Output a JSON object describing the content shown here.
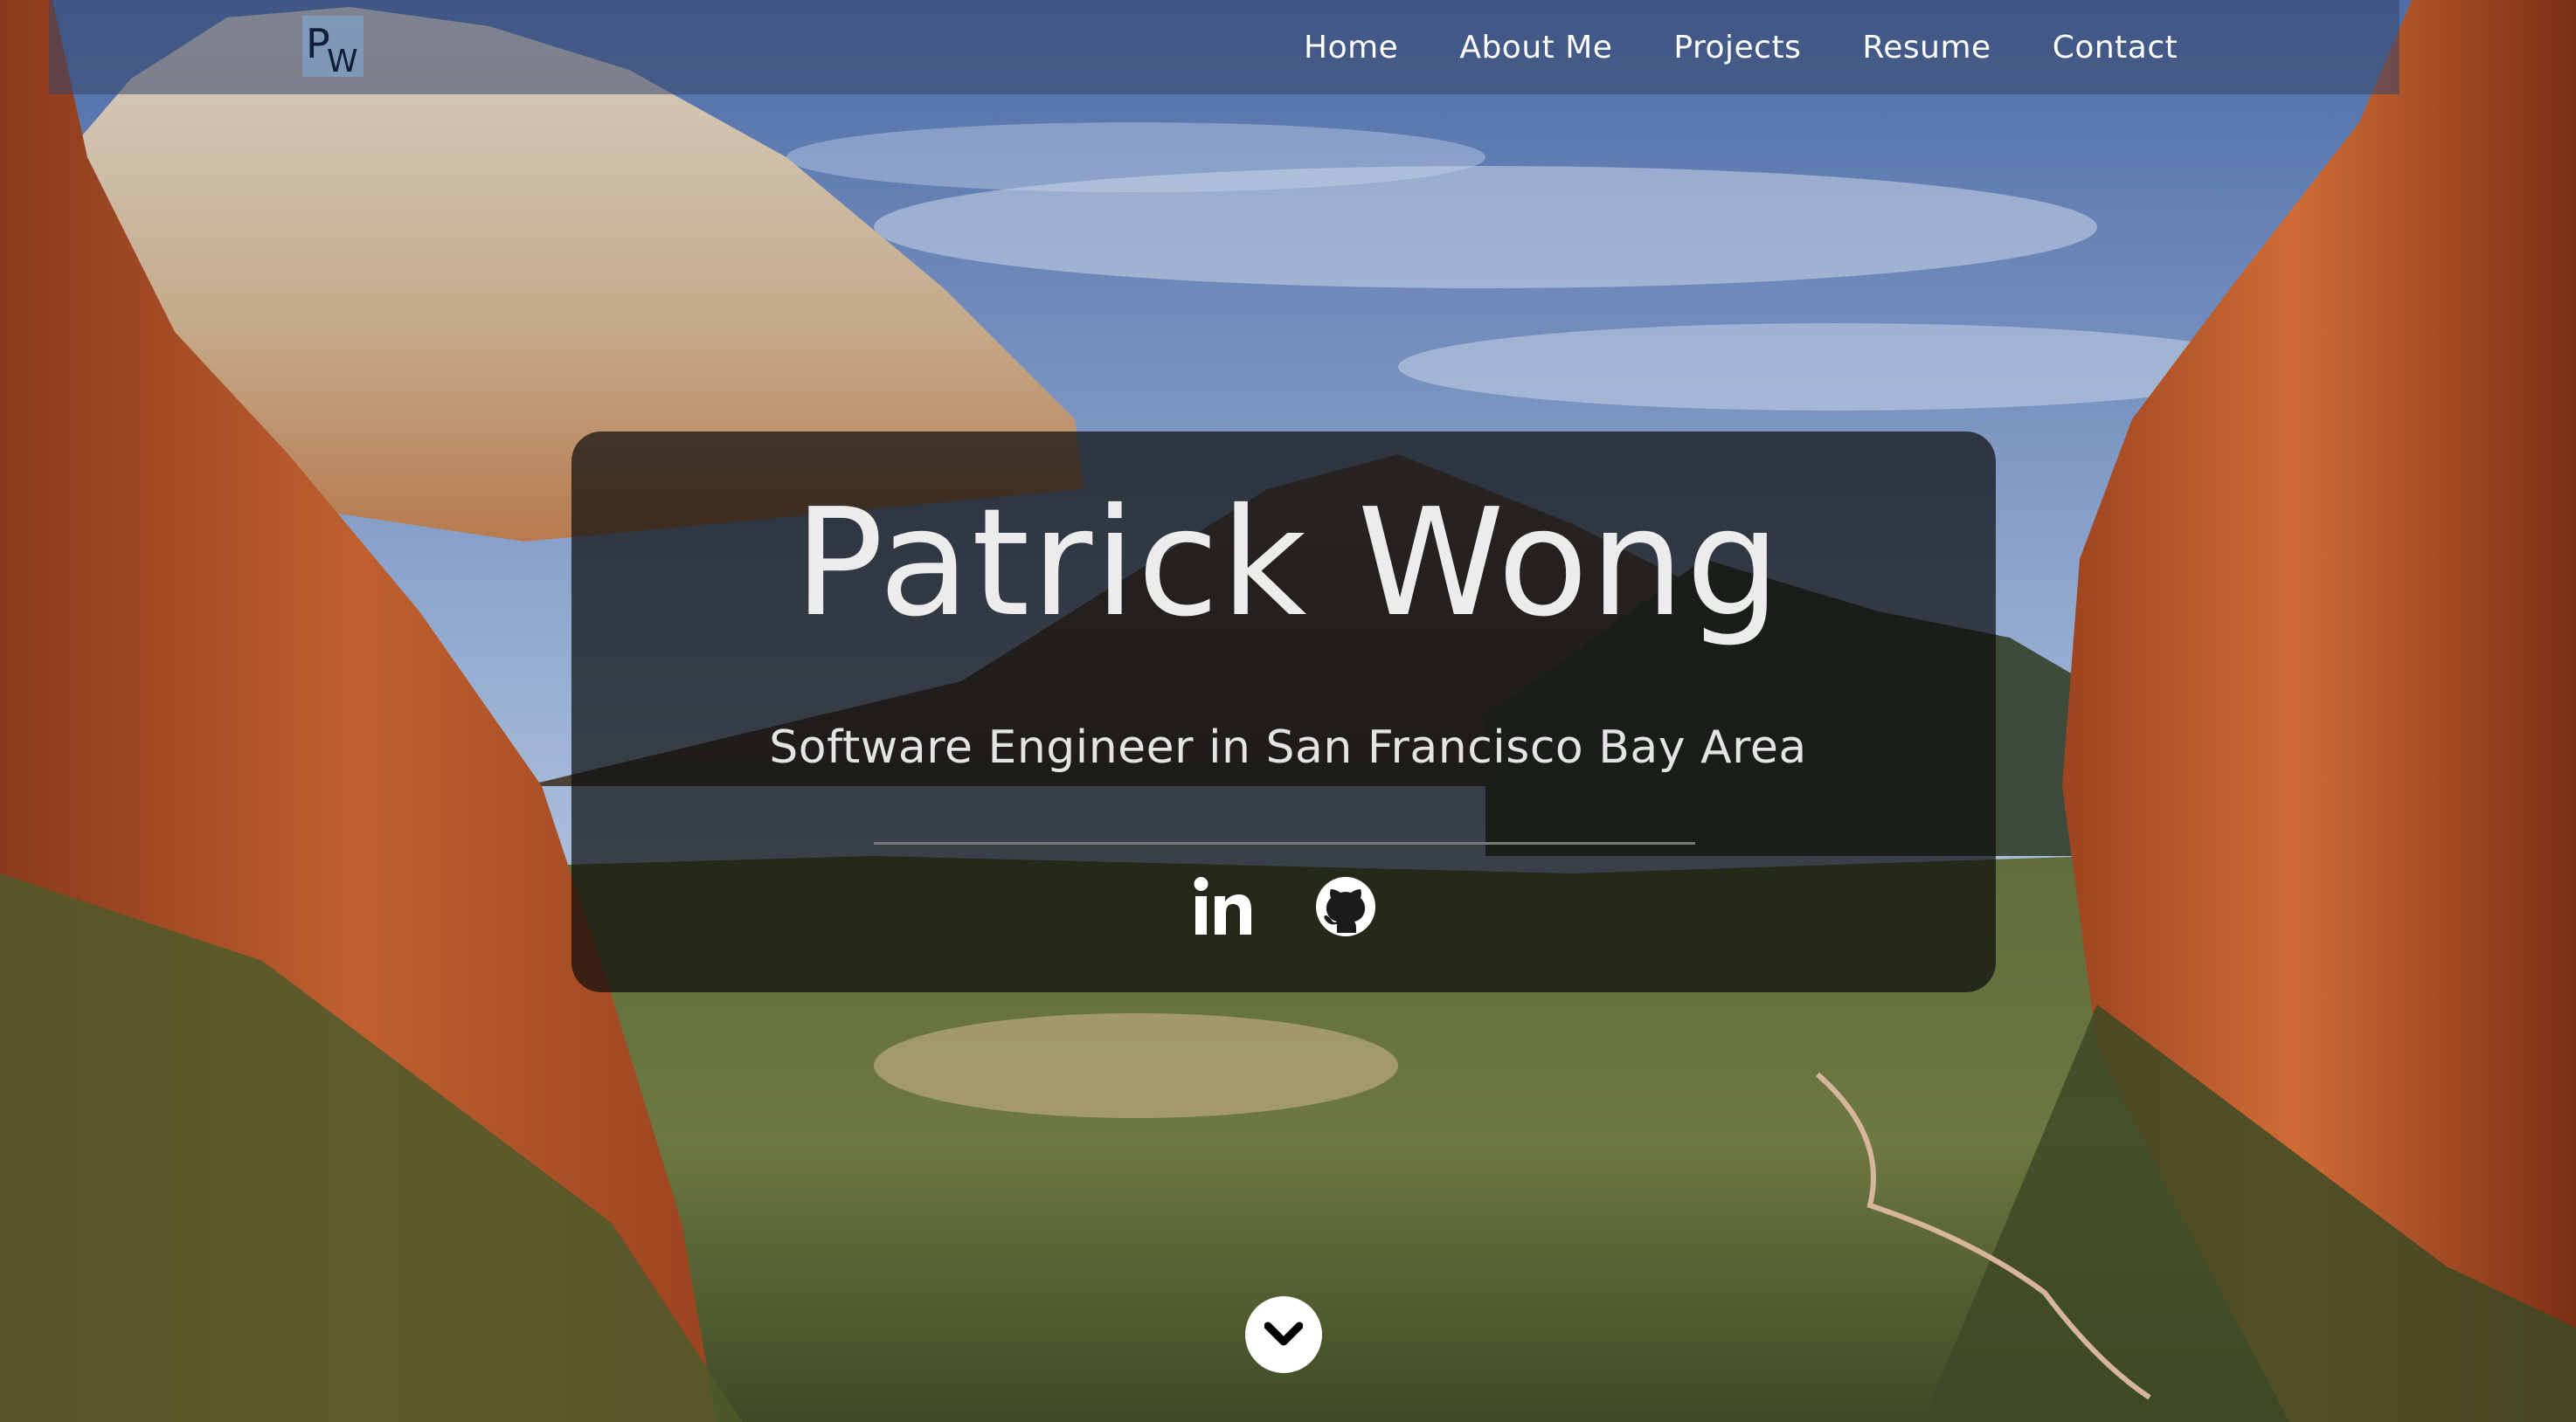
{
  "nav": {
    "logo_text": "PW",
    "links": [
      "Home",
      "About Me",
      "Projects",
      "Resume",
      "Contact"
    ]
  },
  "hero": {
    "name": "Patrick Wong",
    "subtitle": "Software Engineer in San Francisco Bay Area"
  },
  "social": {
    "icons": [
      "linkedin-icon",
      "github-icon"
    ]
  },
  "scroll": {
    "icon": "chevron-down-icon"
  },
  "colors": {
    "navbar_bg": "#374669",
    "card_bg": "#0c0c0c",
    "text": "#ececec",
    "scroll_button_bg": "#ffffff"
  }
}
